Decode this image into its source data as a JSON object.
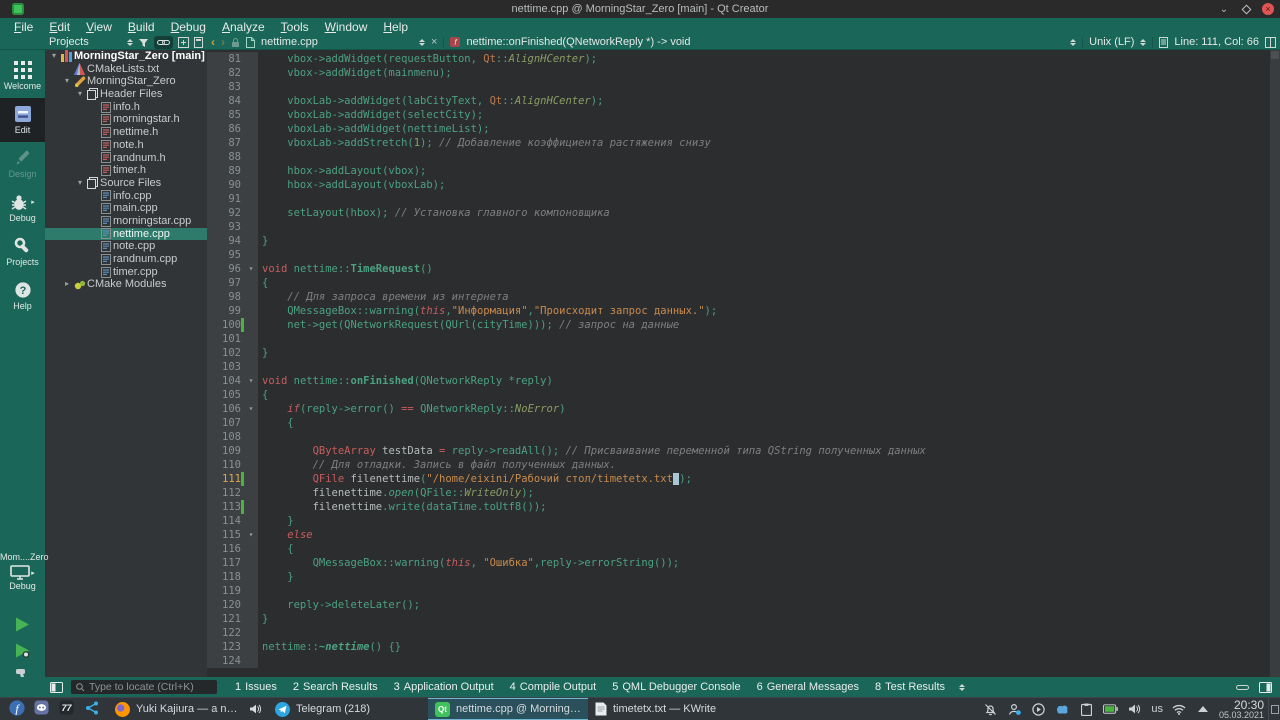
{
  "colors": {
    "accent_teal": "#1a675a",
    "editor_bg": "#2b2d2f",
    "tree_selection": "#2e7b6b",
    "changed_line_marker": "#49b43f",
    "qt_green": "#3ec259",
    "active_task_border": "#6fb7d0"
  },
  "icons": {
    "dropdown": "double-triangle",
    "tree-collapse": "▾",
    "tree-expand": "▸",
    "fold-marker": "▾",
    "close": "×",
    "window-minimize": "∨",
    "window-maximize": "◇",
    "window-close": "×",
    "search": "magnifier",
    "keyboard-layout": "us"
  },
  "window": {
    "title": "nettime.cpp @ MorningStar_Zero [main] - Qt Creator"
  },
  "menu": {
    "items": [
      "File",
      "Edit",
      "View",
      "Build",
      "Debug",
      "Analyze",
      "Tools",
      "Window",
      "Help"
    ]
  },
  "toolbar": {
    "projects_label": "Projects",
    "open_file": "nettime.cpp",
    "symbol": "nettime::onFinished(QNetworkReply *) -> void",
    "line_ending": "Unix (LF)",
    "cursor_pos": "Line: 111, Col: 66"
  },
  "sidebar": {
    "modes": [
      {
        "label": "Welcome",
        "icon": "welcome"
      },
      {
        "label": "Edit",
        "icon": "edit",
        "selected": true
      },
      {
        "label": "Design",
        "icon": "design",
        "disabled": true
      },
      {
        "label": "Debug",
        "icon": "debug",
        "flyout": true
      },
      {
        "label": "Projects",
        "icon": "projects"
      },
      {
        "label": "Help",
        "icon": "help"
      }
    ],
    "kit": {
      "project_short": "Mom....Zero",
      "config": "Debug"
    },
    "run_buttons": [
      {
        "icon": "run"
      },
      {
        "icon": "run-debug"
      },
      {
        "icon": "build"
      }
    ]
  },
  "project_tree": {
    "items": [
      {
        "label": "MorningStar_Zero [main]",
        "depth": 0,
        "icon": "project",
        "arrow": "open",
        "root": true
      },
      {
        "label": "CMakeLists.txt",
        "depth": 1,
        "icon": "cmake-file",
        "arrow": "none"
      },
      {
        "label": "MorningStar_Zero",
        "depth": 1,
        "icon": "subproject",
        "arrow": "open"
      },
      {
        "label": "Header Files",
        "depth": 2,
        "icon": "folder",
        "arrow": "open"
      },
      {
        "label": "info.h",
        "depth": 3,
        "icon": "header",
        "arrow": "none"
      },
      {
        "label": "morningstar.h",
        "depth": 3,
        "icon": "header",
        "arrow": "none"
      },
      {
        "label": "nettime.h",
        "depth": 3,
        "icon": "header",
        "arrow": "none"
      },
      {
        "label": "note.h",
        "depth": 3,
        "icon": "header",
        "arrow": "none"
      },
      {
        "label": "randnum.h",
        "depth": 3,
        "icon": "header",
        "arrow": "none"
      },
      {
        "label": "timer.h",
        "depth": 3,
        "icon": "header",
        "arrow": "none"
      },
      {
        "label": "Source Files",
        "depth": 2,
        "icon": "folder",
        "arrow": "open"
      },
      {
        "label": "info.cpp",
        "depth": 3,
        "icon": "source",
        "arrow": "none"
      },
      {
        "label": "main.cpp",
        "depth": 3,
        "icon": "source",
        "arrow": "none"
      },
      {
        "label": "morningstar.cpp",
        "depth": 3,
        "icon": "source",
        "arrow": "none"
      },
      {
        "label": "nettime.cpp",
        "depth": 3,
        "icon": "source",
        "arrow": "none",
        "selected": true
      },
      {
        "label": "note.cpp",
        "depth": 3,
        "icon": "source",
        "arrow": "none"
      },
      {
        "label": "randnum.cpp",
        "depth": 3,
        "icon": "source",
        "arrow": "none"
      },
      {
        "label": "timer.cpp",
        "depth": 3,
        "icon": "source",
        "arrow": "none"
      },
      {
        "label": "CMake Modules",
        "depth": 1,
        "icon": "cmake-folder",
        "arrow": "closed"
      }
    ]
  },
  "editor": {
    "lines": [
      {
        "n": 81,
        "s": [
          [
            "    vbox->addWidget(requestButton, ",
            ""
          ],
          [
            "Qt",
            "q"
          ],
          [
            "::",
            ""
          ],
          [
            "AlignHCenter",
            "e"
          ],
          [
            ");",
            ""
          ]
        ]
      },
      {
        "n": 82,
        "s": [
          [
            "    vbox->addWidget(mainmenu);",
            ""
          ]
        ]
      },
      {
        "n": 83,
        "s": []
      },
      {
        "n": 84,
        "s": [
          [
            "    vboxLab->addWidget(labCityText, ",
            ""
          ],
          [
            "Qt",
            "q"
          ],
          [
            "::",
            ""
          ],
          [
            "AlignHCenter",
            "e"
          ],
          [
            ");",
            ""
          ]
        ]
      },
      {
        "n": 85,
        "s": [
          [
            "    vboxLab->addWidget(selectCity);",
            ""
          ]
        ]
      },
      {
        "n": 86,
        "s": [
          [
            "    vboxLab->addWidget(nettimeList);",
            ""
          ]
        ]
      },
      {
        "n": 87,
        "s": [
          [
            "    vboxLab->addStretch(",
            ""
          ],
          [
            "1",
            "n"
          ],
          [
            "); ",
            ""
          ],
          [
            "// Добавление коэффициента растяжения снизу",
            "c"
          ]
        ]
      },
      {
        "n": 88,
        "s": []
      },
      {
        "n": 89,
        "s": [
          [
            "    hbox->addLayout(vbox);",
            ""
          ]
        ]
      },
      {
        "n": 90,
        "s": [
          [
            "    hbox->addLayout(vboxLab);",
            ""
          ]
        ]
      },
      {
        "n": 91,
        "s": []
      },
      {
        "n": 92,
        "s": [
          [
            "    setLayout(hbox); ",
            ""
          ],
          [
            "// Установка главного компоновщика",
            "c"
          ]
        ]
      },
      {
        "n": 93,
        "s": []
      },
      {
        "n": 94,
        "s": [
          [
            "}",
            ""
          ]
        ]
      },
      {
        "n": 95,
        "s": []
      },
      {
        "n": 96,
        "fold": true,
        "s": [
          [
            "void",
            "k"
          ],
          [
            " nettime::",
            ""
          ],
          [
            "TimeRequest",
            "m"
          ],
          [
            "()",
            ""
          ]
        ]
      },
      {
        "n": 97,
        "s": [
          [
            "{",
            ""
          ]
        ]
      },
      {
        "n": 98,
        "s": [
          [
            "    ",
            ""
          ],
          [
            "// Для запроса времени из интернета",
            "c"
          ]
        ]
      },
      {
        "n": 99,
        "s": [
          [
            "    QMessageBox::warning(",
            ""
          ],
          [
            "this",
            "ki"
          ],
          [
            ",",
            ""
          ],
          [
            "\"Информация\"",
            "s"
          ],
          [
            ",",
            ""
          ],
          [
            "\"Происходит запрос данных.\"",
            "s"
          ],
          [
            ");",
            ""
          ]
        ]
      },
      {
        "n": 100,
        "chg": true,
        "s": [
          [
            "    net->get(QNetworkRequest(QUrl(cityTime))); ",
            ""
          ],
          [
            "// запрос на данные",
            "c"
          ]
        ]
      },
      {
        "n": 101,
        "s": []
      },
      {
        "n": 102,
        "s": [
          [
            "}",
            ""
          ]
        ]
      },
      {
        "n": 103,
        "s": []
      },
      {
        "n": 104,
        "fold": true,
        "s": [
          [
            "void",
            "k"
          ],
          [
            " nettime::",
            ""
          ],
          [
            "onFinished",
            "m"
          ],
          [
            "(QNetworkReply *reply)",
            ""
          ]
        ]
      },
      {
        "n": 105,
        "s": [
          [
            "{",
            ""
          ]
        ]
      },
      {
        "n": 106,
        "fold": true,
        "s": [
          [
            "    ",
            ""
          ],
          [
            "if",
            "ki"
          ],
          [
            "(reply->error() ",
            ""
          ],
          [
            "==",
            "o"
          ],
          [
            " QNetworkReply::",
            ""
          ],
          [
            "NoError",
            "e"
          ],
          [
            ")",
            ""
          ]
        ]
      },
      {
        "n": 107,
        "s": [
          [
            "    {",
            ""
          ]
        ]
      },
      {
        "n": 108,
        "s": []
      },
      {
        "n": 109,
        "s": [
          [
            "        ",
            ""
          ],
          [
            "QByteArray",
            "t"
          ],
          [
            " ",
            ""
          ],
          [
            "testData",
            "v"
          ],
          [
            " ",
            ""
          ],
          [
            "=",
            "o"
          ],
          [
            " reply->readAll(); ",
            ""
          ],
          [
            "// Присваивание переменной типа QString полученных данных",
            "c"
          ]
        ]
      },
      {
        "n": 110,
        "s": [
          [
            "        ",
            ""
          ],
          [
            "// Для отладки. Запись в файл полученных данных.",
            "c"
          ]
        ]
      },
      {
        "n": 111,
        "chg": true,
        "cur": true,
        "s": [
          [
            "        ",
            ""
          ],
          [
            "QFile",
            "t"
          ],
          [
            " ",
            ""
          ],
          [
            "filenettime",
            "v"
          ],
          [
            "(",
            ""
          ],
          [
            "\"/home/eixini/Рабочий стол/timetetx.txt",
            "s"
          ],
          [
            "\"",
            "cb"
          ],
          [
            ");",
            ""
          ]
        ]
      },
      {
        "n": 112,
        "s": [
          [
            "        ",
            ""
          ],
          [
            "filenettime",
            "v"
          ],
          [
            ".",
            ""
          ],
          [
            "open",
            "i"
          ],
          [
            "(QFile::",
            ""
          ],
          [
            "WriteOnly",
            "e"
          ],
          [
            ");",
            ""
          ]
        ]
      },
      {
        "n": 113,
        "chg": true,
        "s": [
          [
            "        ",
            ""
          ],
          [
            "filenettime",
            "v"
          ],
          [
            ".write(dataTime.toUtf8());",
            ""
          ]
        ]
      },
      {
        "n": 114,
        "s": [
          [
            "    }",
            ""
          ]
        ]
      },
      {
        "n": 115,
        "fold": true,
        "s": [
          [
            "    ",
            ""
          ],
          [
            "else",
            "ki"
          ]
        ]
      },
      {
        "n": 116,
        "s": [
          [
            "    {",
            ""
          ]
        ]
      },
      {
        "n": 117,
        "s": [
          [
            "        QMessageBox::warning(",
            ""
          ],
          [
            "this",
            "ki"
          ],
          [
            ", ",
            ""
          ],
          [
            "\"Ошибка\"",
            "s"
          ],
          [
            ",reply->errorString());",
            ""
          ]
        ]
      },
      {
        "n": 118,
        "s": [
          [
            "    }",
            ""
          ]
        ]
      },
      {
        "n": 119,
        "s": []
      },
      {
        "n": 120,
        "s": [
          [
            "    reply->deleteLater();",
            ""
          ]
        ]
      },
      {
        "n": 121,
        "s": [
          [
            "}",
            ""
          ]
        ]
      },
      {
        "n": 122,
        "s": []
      },
      {
        "n": 123,
        "s": [
          [
            "nettime::",
            ""
          ],
          [
            "~nettime",
            "mi"
          ],
          [
            "() {}",
            ""
          ]
        ]
      },
      {
        "n": 124,
        "s": []
      }
    ]
  },
  "locator": {
    "placeholder": "Type to locate (Ctrl+K)"
  },
  "output_panes": [
    {
      "key": "1",
      "label": "Issues"
    },
    {
      "key": "2",
      "label": "Search Results"
    },
    {
      "key": "3",
      "label": "Application Output"
    },
    {
      "key": "4",
      "label": "Compile Output"
    },
    {
      "key": "5",
      "label": "QML Debugger Console"
    },
    {
      "key": "6",
      "label": "General Messages"
    },
    {
      "key": "8",
      "label": "Test Results"
    }
  ],
  "taskbar": {
    "launchers": [
      {
        "icon": "fedora"
      },
      {
        "icon": "discord"
      },
      {
        "icon": "seven7"
      },
      {
        "icon": "share"
      }
    ],
    "tasks": [
      {
        "icon": "firefox",
        "title": "Yuki Kajiura — a new wo...",
        "audio": true
      },
      {
        "icon": "telegram",
        "title": "Telegram (218)"
      },
      {
        "icon": "qtcreator",
        "title": "nettime.cpp @ MorningStar_...",
        "active": true
      },
      {
        "icon": "kwrite",
        "title": "timetetx.txt — KWrite"
      }
    ],
    "tray": [
      "notifications-muted",
      "user-switch",
      "media-player",
      "weather",
      "clipboard",
      "battery",
      "volume"
    ],
    "keyboard_layout": "us",
    "tray_after": [
      "network-wifi",
      "expand-tray"
    ],
    "clock": {
      "time": "20:30",
      "date": "05.03.2021"
    }
  }
}
